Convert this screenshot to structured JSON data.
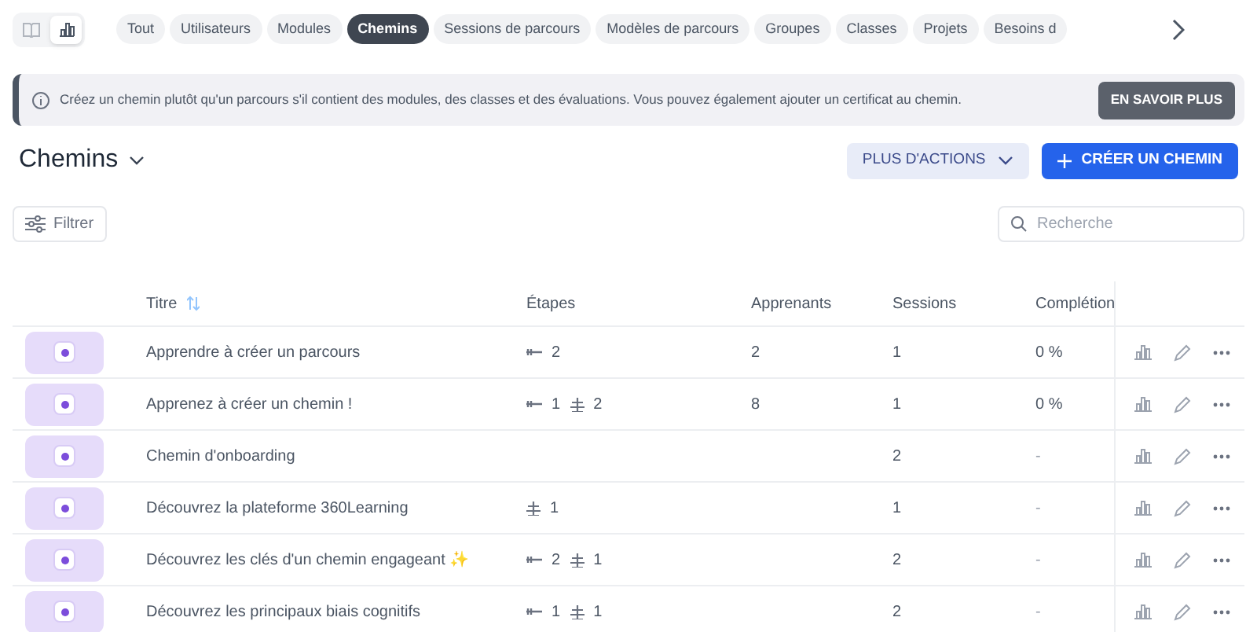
{
  "view_toggle": [
    {
      "kind": "book",
      "selected": false
    },
    {
      "kind": "chart",
      "selected": true
    }
  ],
  "tabs": [
    {
      "label": "Tout",
      "selected": false
    },
    {
      "label": "Utilisateurs",
      "selected": false
    },
    {
      "label": "Modules",
      "selected": false
    },
    {
      "label": "Chemins",
      "selected": true
    },
    {
      "label": "Sessions de parcours",
      "selected": false
    },
    {
      "label": "Modèles de parcours",
      "selected": false
    },
    {
      "label": "Groupes",
      "selected": false
    },
    {
      "label": "Classes",
      "selected": false
    },
    {
      "label": "Projets",
      "selected": false
    },
    {
      "label": "Besoins d",
      "selected": false
    }
  ],
  "banner": {
    "text": "Créez un chemin plutôt qu'un parcours s'il contient des modules, des classes et des évaluations. Vous pouvez également ajouter un certificat au chemin.",
    "button": "EN SAVOIR PLUS"
  },
  "page_title": "Chemins",
  "more_actions": "PLUS D'ACTIONS",
  "create_button": "CRÉER UN CHEMIN",
  "filter": "Filtrer",
  "search": {
    "placeholder": "Recherche"
  },
  "table": {
    "columns": [
      "Titre",
      "Étapes",
      "Apprenants",
      "Sessions",
      "Complétion"
    ],
    "rows": [
      {
        "title": "Apprendre à créer un parcours",
        "steps": [
          {
            "kind": "module",
            "count": "2"
          }
        ],
        "learners": "2",
        "sessions": "1",
        "completion": "0 %"
      },
      {
        "title": "Apprenez à créer un chemin !",
        "steps": [
          {
            "kind": "module",
            "count": "1"
          },
          {
            "kind": "class",
            "count": "2"
          }
        ],
        "learners": "8",
        "sessions": "1",
        "completion": "0 %"
      },
      {
        "title": "Chemin d'onboarding",
        "steps": [],
        "learners": "",
        "sessions": "2",
        "completion": "-"
      },
      {
        "title": "Découvrez la plateforme 360Learning",
        "steps": [
          {
            "kind": "class",
            "count": "1"
          }
        ],
        "learners": "",
        "sessions": "1",
        "completion": "-"
      },
      {
        "title": "Découvrez les clés d'un chemin engageant ✨",
        "steps": [
          {
            "kind": "module",
            "count": "2"
          },
          {
            "kind": "class",
            "count": "1"
          }
        ],
        "learners": "",
        "sessions": "2",
        "completion": "-"
      },
      {
        "title": "Découvrez les principaux biais cognitifs",
        "steps": [
          {
            "kind": "module",
            "count": "1"
          },
          {
            "kind": "class",
            "count": "1"
          }
        ],
        "learners": "",
        "sessions": "2",
        "completion": "-"
      }
    ]
  }
}
